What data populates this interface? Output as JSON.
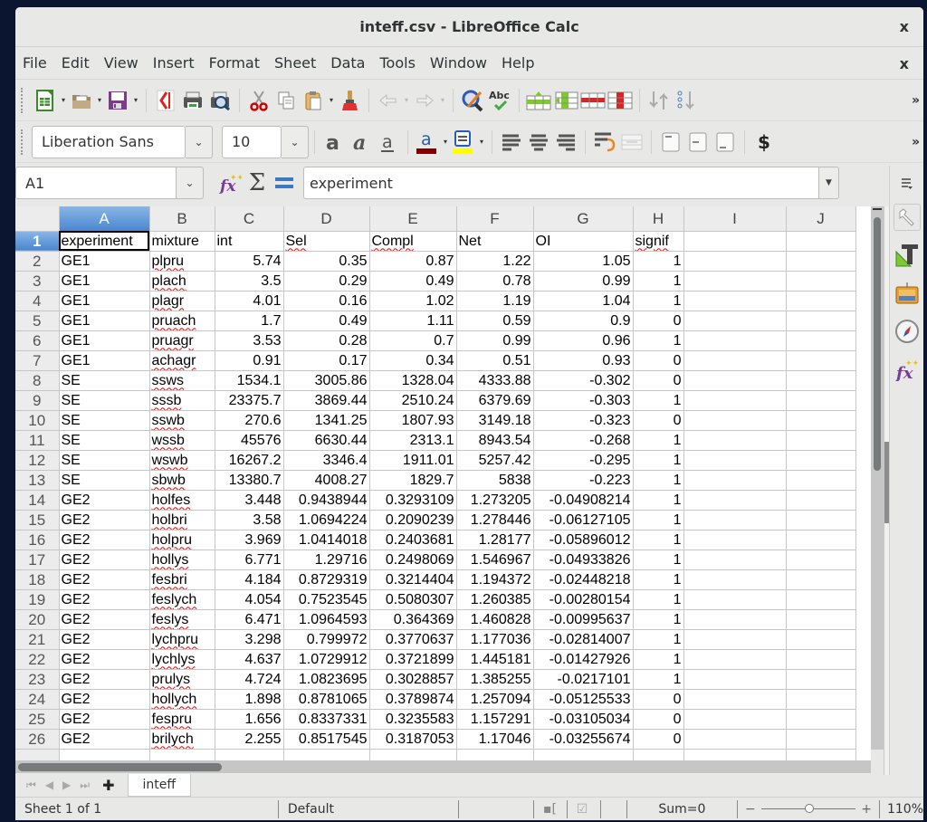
{
  "window": {
    "title": "inteff.csv - LibreOffice Calc",
    "close_label": "x"
  },
  "menu": {
    "items": [
      "File",
      "Edit",
      "View",
      "Insert",
      "Format",
      "Sheet",
      "Data",
      "Tools",
      "Window",
      "Help"
    ],
    "close_label": "x"
  },
  "toolbar": {
    "more_label": "»"
  },
  "formatting": {
    "font_name": "Liberation Sans",
    "font_size": "10",
    "font_color": "#800000",
    "highlight_color": "#ffff00",
    "currency_symbol": "$",
    "more_label": "»"
  },
  "formula_bar": {
    "name_box": "A1",
    "content": "experiment"
  },
  "sheet": {
    "columns": [
      "A",
      "B",
      "C",
      "D",
      "E",
      "F",
      "G",
      "H",
      "I",
      "J"
    ],
    "selected_column": "A",
    "header_row": [
      "experiment",
      "mixture",
      "int",
      "Sel",
      "Compl",
      "Net",
      "OI",
      "signif"
    ],
    "rows": [
      {
        "n": "2",
        "cells": [
          "GE1",
          "plpru",
          "5.74",
          "0.35",
          "0.87",
          "1.22",
          "1.05",
          "1"
        ]
      },
      {
        "n": "3",
        "cells": [
          "GE1",
          "plach",
          "3.5",
          "0.29",
          "0.49",
          "0.78",
          "0.99",
          "1"
        ]
      },
      {
        "n": "4",
        "cells": [
          "GE1",
          "plagr",
          "4.01",
          "0.16",
          "1.02",
          "1.19",
          "1.04",
          "1"
        ]
      },
      {
        "n": "5",
        "cells": [
          "GE1",
          "pruach",
          "1.7",
          "0.49",
          "1.11",
          "0.59",
          "0.9",
          "0"
        ]
      },
      {
        "n": "6",
        "cells": [
          "GE1",
          "pruagr",
          "3.53",
          "0.28",
          "0.7",
          "0.99",
          "0.96",
          "1"
        ]
      },
      {
        "n": "7",
        "cells": [
          "GE1",
          "achagr",
          "0.91",
          "0.17",
          "0.34",
          "0.51",
          "0.93",
          "0"
        ]
      },
      {
        "n": "8",
        "cells": [
          "SE",
          "ssws",
          "1534.1",
          "3005.86",
          "1328.04",
          "4333.88",
          "-0.302",
          "0"
        ]
      },
      {
        "n": "9",
        "cells": [
          "SE",
          "sssb",
          "23375.7",
          "3869.44",
          "2510.24",
          "6379.69",
          "-0.303",
          "1"
        ]
      },
      {
        "n": "10",
        "cells": [
          "SE",
          "sswb",
          "270.6",
          "1341.25",
          "1807.93",
          "3149.18",
          "-0.323",
          "0"
        ]
      },
      {
        "n": "11",
        "cells": [
          "SE",
          "wssb",
          "45576",
          "6630.44",
          "2313.1",
          "8943.54",
          "-0.268",
          "1"
        ]
      },
      {
        "n": "12",
        "cells": [
          "SE",
          "wswb",
          "16267.2",
          "3346.4",
          "1911.01",
          "5257.42",
          "-0.295",
          "1"
        ]
      },
      {
        "n": "13",
        "cells": [
          "SE",
          "sbwb",
          "13380.7",
          "4008.27",
          "1829.7",
          "5838",
          "-0.223",
          "1"
        ]
      },
      {
        "n": "14",
        "cells": [
          "GE2",
          "holfes",
          "3.448",
          "0.9438944",
          "0.3293109",
          "1.273205",
          "-0.04908214",
          "1"
        ]
      },
      {
        "n": "15",
        "cells": [
          "GE2",
          "holbri",
          "3.58",
          "1.0694224",
          "0.2090239",
          "1.278446",
          "-0.06127105",
          "1"
        ]
      },
      {
        "n": "16",
        "cells": [
          "GE2",
          "holpru",
          "3.969",
          "1.0414018",
          "0.2403681",
          "1.28177",
          "-0.05896012",
          "1"
        ]
      },
      {
        "n": "17",
        "cells": [
          "GE2",
          "hollys",
          "6.771",
          "1.29716",
          "0.2498069",
          "1.546967",
          "-0.04933826",
          "1"
        ]
      },
      {
        "n": "18",
        "cells": [
          "GE2",
          "fesbri",
          "4.184",
          "0.8729319",
          "0.3214404",
          "1.194372",
          "-0.02448218",
          "1"
        ]
      },
      {
        "n": "19",
        "cells": [
          "GE2",
          "feslych",
          "4.054",
          "0.7523545",
          "0.5080307",
          "1.260385",
          "-0.00280154",
          "1"
        ]
      },
      {
        "n": "20",
        "cells": [
          "GE2",
          "feslys",
          "6.471",
          "1.0964593",
          "0.364369",
          "1.460828",
          "-0.00995637",
          "1"
        ]
      },
      {
        "n": "21",
        "cells": [
          "GE2",
          "lychpru",
          "3.298",
          "0.799972",
          "0.3770637",
          "1.177036",
          "-0.02814007",
          "1"
        ]
      },
      {
        "n": "22",
        "cells": [
          "GE2",
          "lychlys",
          "4.637",
          "1.0729912",
          "0.3721899",
          "1.445181",
          "-0.01427926",
          "1"
        ]
      },
      {
        "n": "23",
        "cells": [
          "GE2",
          "prulys",
          "4.724",
          "1.0823695",
          "0.3028857",
          "1.385255",
          "-0.0217101",
          "1"
        ]
      },
      {
        "n": "24",
        "cells": [
          "GE2",
          "hollych",
          "1.898",
          "0.8781065",
          "0.3789874",
          "1.257094",
          "-0.05125533",
          "0"
        ]
      },
      {
        "n": "25",
        "cells": [
          "GE2",
          "fespru",
          "1.656",
          "0.8337331",
          "0.3235583",
          "1.157291",
          "-0.03105034",
          "0"
        ]
      },
      {
        "n": "26",
        "cells": [
          "GE2",
          "brilych",
          "2.255",
          "0.8517545",
          "0.3187053",
          "1.17046",
          "-0.03255674",
          "0"
        ]
      }
    ]
  },
  "tabs": {
    "sheets": [
      "inteff"
    ],
    "active": "inteff"
  },
  "status": {
    "sheet_info": "Sheet 1 of 1",
    "page_style": "Default",
    "sum": "Sum=0",
    "zoom": "110%",
    "zoom_level_percent": 110
  }
}
